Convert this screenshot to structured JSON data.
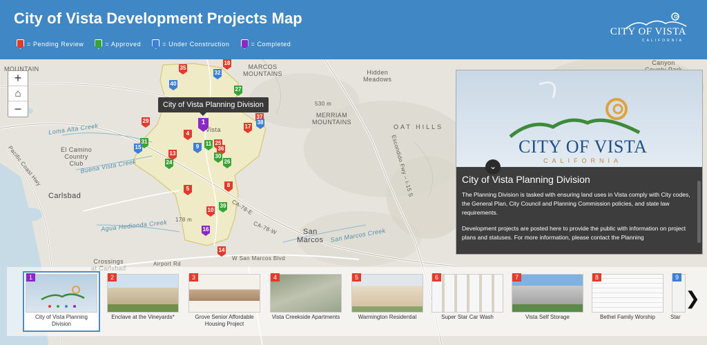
{
  "header": {
    "title": "City of Vista Development Projects Map",
    "logo_text": "CITY OF VISTA",
    "logo_sub": "CALIFORNIA",
    "legend": [
      {
        "color": "#e23a2b",
        "label": "= Pending Review"
      },
      {
        "color": "#3aa336",
        "label": "= Approved"
      },
      {
        "color": "#3d7fd6",
        "label": "= Under Construction"
      },
      {
        "color": "#8b28c8",
        "label": "= Completed"
      }
    ]
  },
  "map": {
    "zoom_in": "+",
    "home": "⌂",
    "zoom_out": "−",
    "tooltip": "City of Vista Planning Division",
    "labels": {
      "hidden_meadows": "Hidden\nMeadows",
      "marcos_mountains": "MARCOS\nMOUNTAINS",
      "merriam_mountains": "MERRIAM\nMOUNTAINS",
      "oat_hills": "OAT HILLS",
      "canyon_park": "Canyon\nCounty Park",
      "el_camino": "El Camino\nCountry\nClub",
      "carlsbad": "Carlsbad",
      "san_marcos": "San\nMarcos",
      "crossings": "Crossings\nat Carlsbad",
      "loma_alta": "Loma Alta Creek",
      "buena_vista": "Buena Vista Creek",
      "hedionda": "Agua Hedionda Creek",
      "san_marcos_creek": "San Marcos Creek",
      "mountain": "MOUNTAIN",
      "vista": "Vista",
      "escondido": "Escondido Fwy – I-15 S",
      "ca78": "CA-78-E",
      "ca78w": "CA-78-W",
      "pacific": "Pacific Coast Hwy",
      "airport": "Airport Rd",
      "w_sm": "W San Marcos Blvd",
      "elev1": "530 m",
      "elev2": "178 m"
    },
    "markers": [
      {
        "n": "35",
        "c": "#e23a2b"
      },
      {
        "n": "18",
        "c": "#e23a2b"
      },
      {
        "n": "32",
        "c": "#3d7fd6"
      },
      {
        "n": "40",
        "c": "#3d7fd6"
      },
      {
        "n": "27",
        "c": "#3aa336"
      },
      {
        "n": "1",
        "c": "#8b28c8"
      },
      {
        "n": "37",
        "c": "#e23a2b"
      },
      {
        "n": "29",
        "c": "#e23a2b"
      },
      {
        "n": "17",
        "c": "#e23a2b"
      },
      {
        "n": "38",
        "c": "#3d7fd6"
      },
      {
        "n": "4",
        "c": "#e23a2b"
      },
      {
        "n": "31",
        "c": "#3aa336"
      },
      {
        "n": "15",
        "c": "#3d7fd6"
      },
      {
        "n": "9",
        "c": "#3d7fd6"
      },
      {
        "n": "11",
        "c": "#3aa336"
      },
      {
        "n": "25",
        "c": "#e23a2b"
      },
      {
        "n": "36",
        "c": "#e23a2b"
      },
      {
        "n": "13",
        "c": "#e23a2b"
      },
      {
        "n": "24",
        "c": "#3aa336"
      },
      {
        "n": "30",
        "c": "#3aa336"
      },
      {
        "n": "26",
        "c": "#3aa336"
      },
      {
        "n": "5",
        "c": "#e23a2b"
      },
      {
        "n": "8",
        "c": "#e23a2b"
      },
      {
        "n": "39",
        "c": "#3aa336"
      },
      {
        "n": "10",
        "c": "#e23a2b"
      },
      {
        "n": "16",
        "c": "#8b28c8"
      },
      {
        "n": "14",
        "c": "#e23a2b"
      }
    ]
  },
  "panel": {
    "title": "City of Vista Planning Division",
    "text1": "The Planning Division is tasked with ensuring land uses in Vista comply with City codes, the General Plan, City Council and Planning Commission policies, and state law requirements.",
    "text2": "Development projects are posted here to provide the public with information on project plans and statuses. For more information, please contact the Planning",
    "logo_city": "CITY OF VISTA",
    "logo_cal": "CALIFORNIA",
    "collapse": "⌄"
  },
  "carousel": {
    "next": "❯",
    "cards": [
      {
        "num": "1",
        "color": "#8b28c8",
        "caption": "City of Vista Planning\nDivision"
      },
      {
        "num": "2",
        "color": "#e23a2b",
        "caption": "Enclave at the Vineyards*"
      },
      {
        "num": "3",
        "color": "#e23a2b",
        "caption": "Grove Senior Affordable\nHousing Project"
      },
      {
        "num": "4",
        "color": "#e23a2b",
        "caption": "Vista Creekside Apartments"
      },
      {
        "num": "5",
        "color": "#e23a2b",
        "caption": "Warmington Residential"
      },
      {
        "num": "6",
        "color": "#e23a2b",
        "caption": "Super Star Car Wash"
      },
      {
        "num": "7",
        "color": "#e23a2b",
        "caption": "Vista Self Storage"
      },
      {
        "num": "8",
        "color": "#e23a2b",
        "caption": "Bethel Family Worship"
      },
      {
        "num": "9",
        "color": "#3d7fd6",
        "caption": "Star"
      }
    ]
  }
}
